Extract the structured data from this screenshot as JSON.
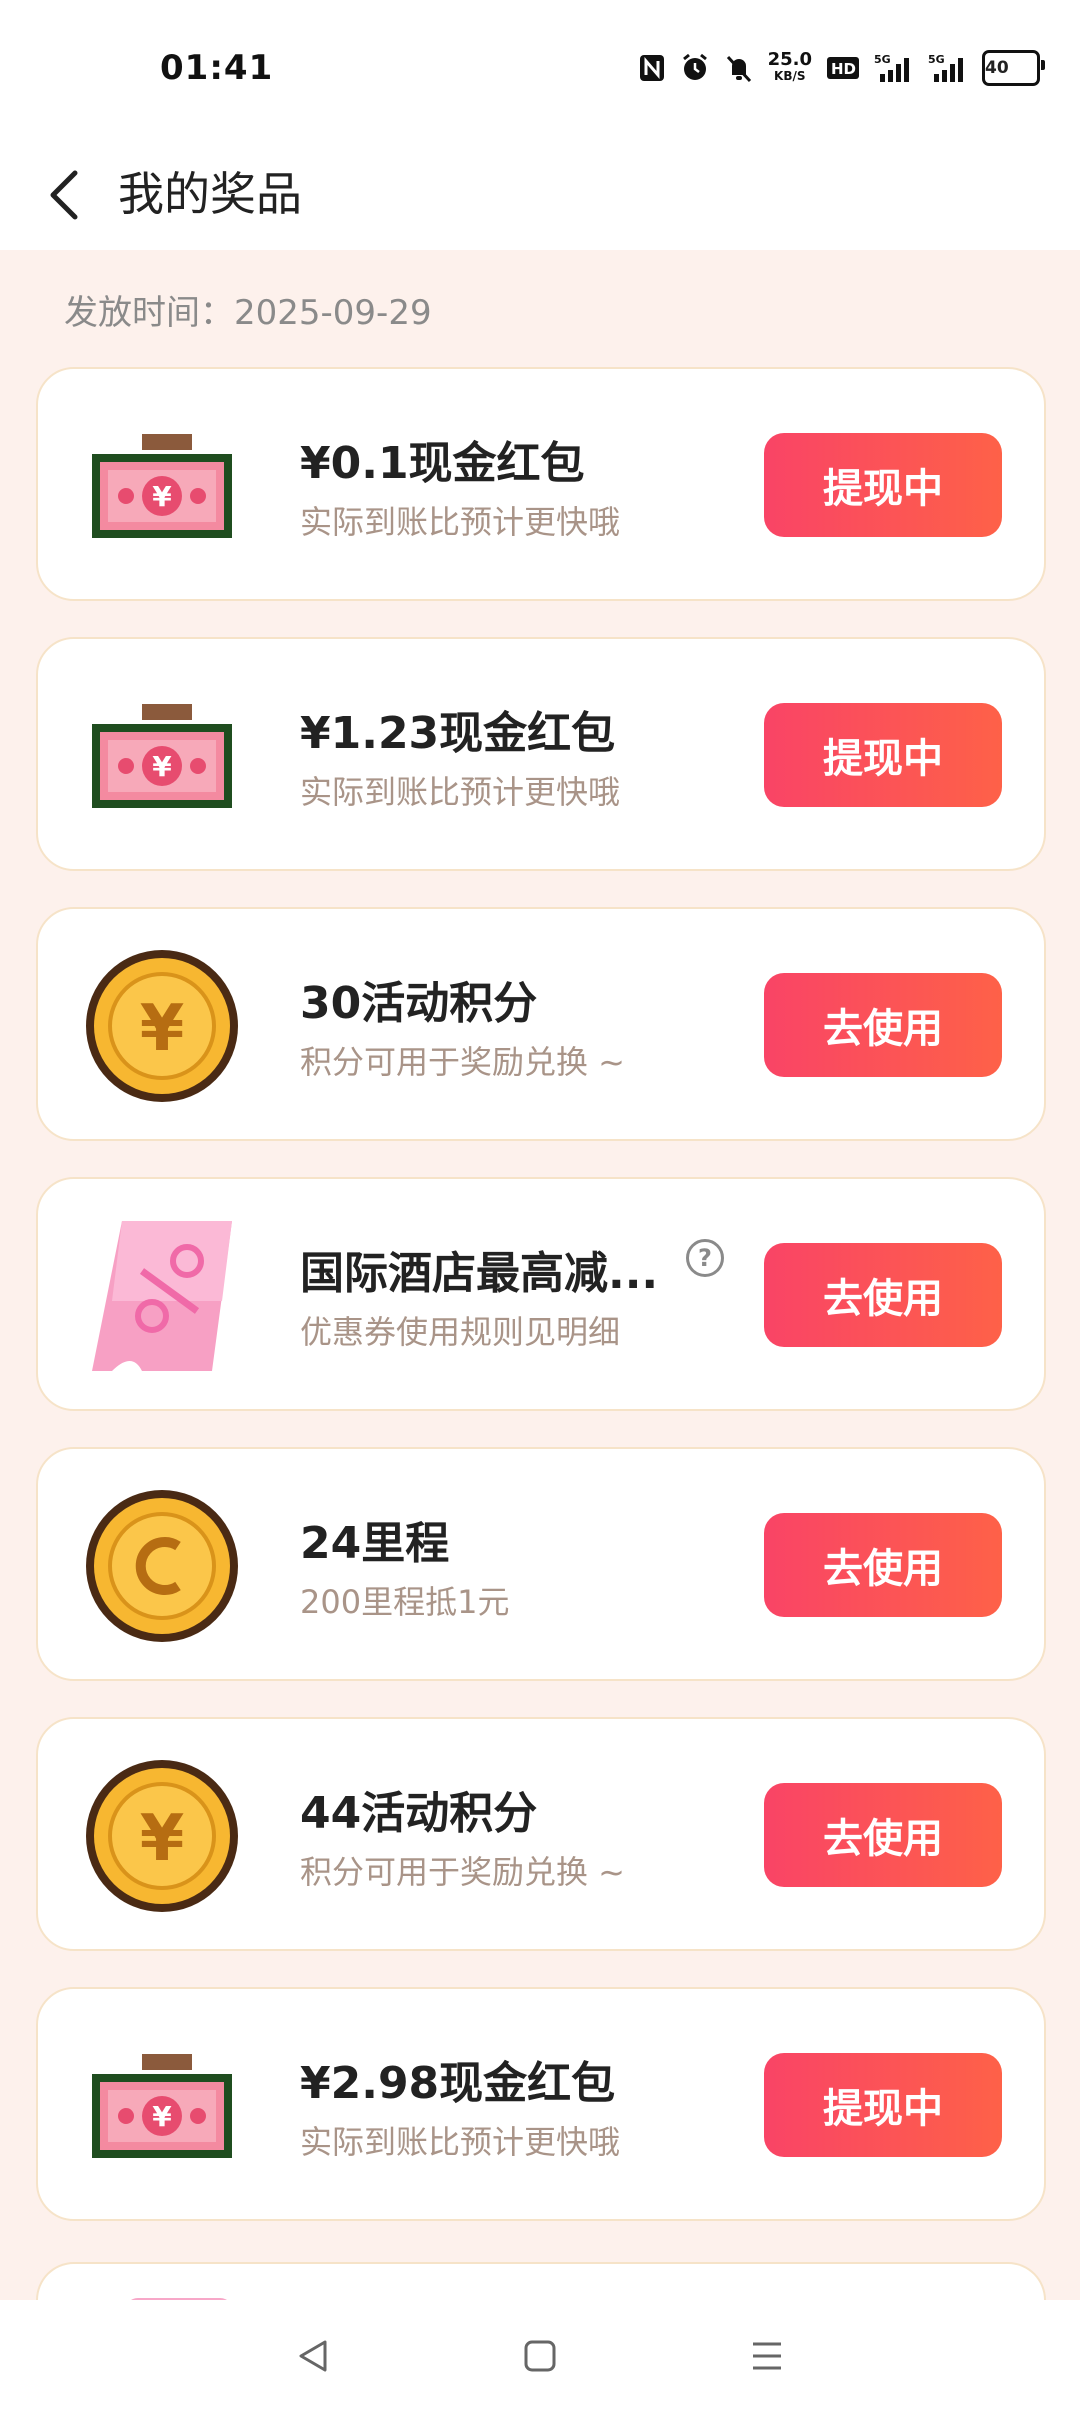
{
  "status_bar": {
    "time": "01:41",
    "net_speed_value": "25.0",
    "net_speed_unit": "KB/S",
    "battery": "40",
    "icons": [
      "nfc-icon",
      "alarm-icon",
      "mute-icon",
      "hd-icon",
      "signal-5g-icon",
      "signal-5g-icon"
    ]
  },
  "header": {
    "title": "我的奖品",
    "back_icon": "chevron-left-icon"
  },
  "date_label": "发放时间：2025-09-29",
  "prizes": [
    {
      "title": "¥0.1现金红包",
      "desc": "实际到账比预计更快哦",
      "action": "提现中",
      "icon": "cash-bill-icon"
    },
    {
      "title": "¥1.23现金红包",
      "desc": "实际到账比预计更快哦",
      "action": "提现中",
      "icon": "cash-bill-icon"
    },
    {
      "title": "30活动积分",
      "desc": "积分可用于奖励兑换 ~",
      "action": "去使用",
      "icon": "yen-coin-icon"
    },
    {
      "title": "国际酒店最高减...",
      "desc": "优惠券使用规则见明细",
      "action": "去使用",
      "icon": "coupon-ticket-icon",
      "help": "?"
    },
    {
      "title": "24里程",
      "desc": "200里程抵1元",
      "action": "去使用",
      "icon": "mileage-coin-icon"
    },
    {
      "title": "44活动积分",
      "desc": "积分可用于奖励兑换 ~",
      "action": "去使用",
      "icon": "yen-coin-icon"
    },
    {
      "title": "¥2.98现金红包",
      "desc": "实际到账比预计更快哦",
      "action": "提现中",
      "icon": "cash-bill-icon"
    }
  ],
  "colors": {
    "page_bg": "#fdf1ec",
    "button_gradient_start": "#f94466",
    "button_gradient_end": "#fe6148",
    "card_border": "#f6e3c8",
    "desc_text": "#a99488"
  },
  "nav_bar": {
    "icons": [
      "back-triangle-icon",
      "home-square-icon",
      "menu-lines-icon"
    ]
  }
}
